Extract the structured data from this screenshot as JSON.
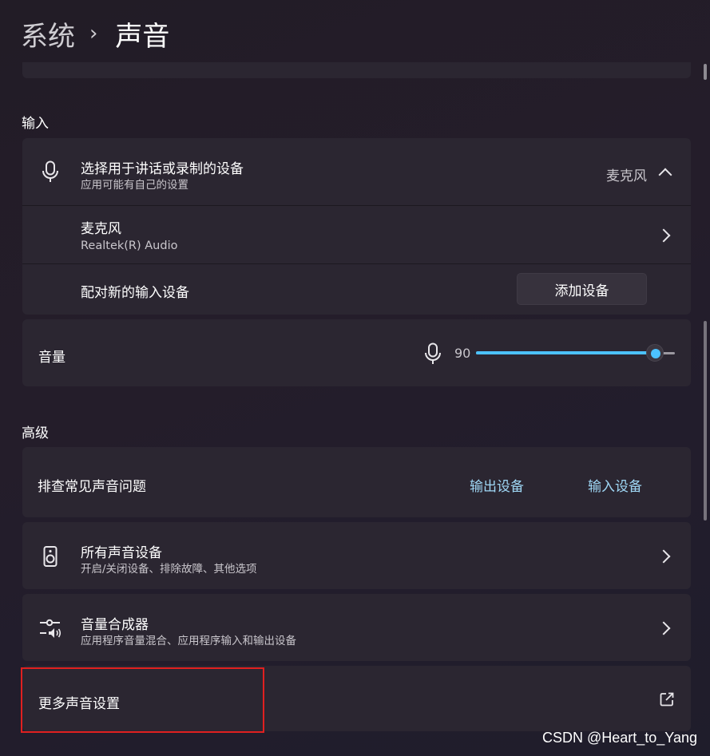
{
  "breadcrumb": {
    "parent": "系统",
    "separator": "›",
    "current": "声音"
  },
  "input_section": {
    "label": "输入",
    "choose_device": {
      "title": "选择用于讲话或录制的设备",
      "subtitle": "应用可能有自己的设置",
      "value": "麦克风"
    },
    "microphone": {
      "title": "麦克风",
      "subtitle": "Realtek(R) Audio"
    },
    "pair_new": {
      "title": "配对新的输入设备",
      "button": "添加设备"
    },
    "volume": {
      "label": "音量",
      "value": "90",
      "level": 0.9
    }
  },
  "advanced_section": {
    "label": "高级",
    "troubleshoot": {
      "title": "排查常见声音问题",
      "link_output": "输出设备",
      "link_input": "输入设备"
    },
    "all_devices": {
      "title": "所有声音设备",
      "subtitle": "开启/关闭设备、排除故障、其他选项"
    },
    "mixer": {
      "title": "音量合成器",
      "subtitle": "应用程序音量混合、应用程序输入和输出设备"
    },
    "more_settings": {
      "title": "更多声音设置"
    }
  },
  "watermark": "CSDN @Heart_to_Yang",
  "colors": {
    "accent": "#4cc2ff",
    "link": "#9fd7f5",
    "highlight_border": "#e02020"
  },
  "icons": [
    "microphone-icon",
    "chevron-up-icon",
    "chevron-right-icon",
    "speaker-icon",
    "mixer-icon",
    "external-link-icon"
  ]
}
